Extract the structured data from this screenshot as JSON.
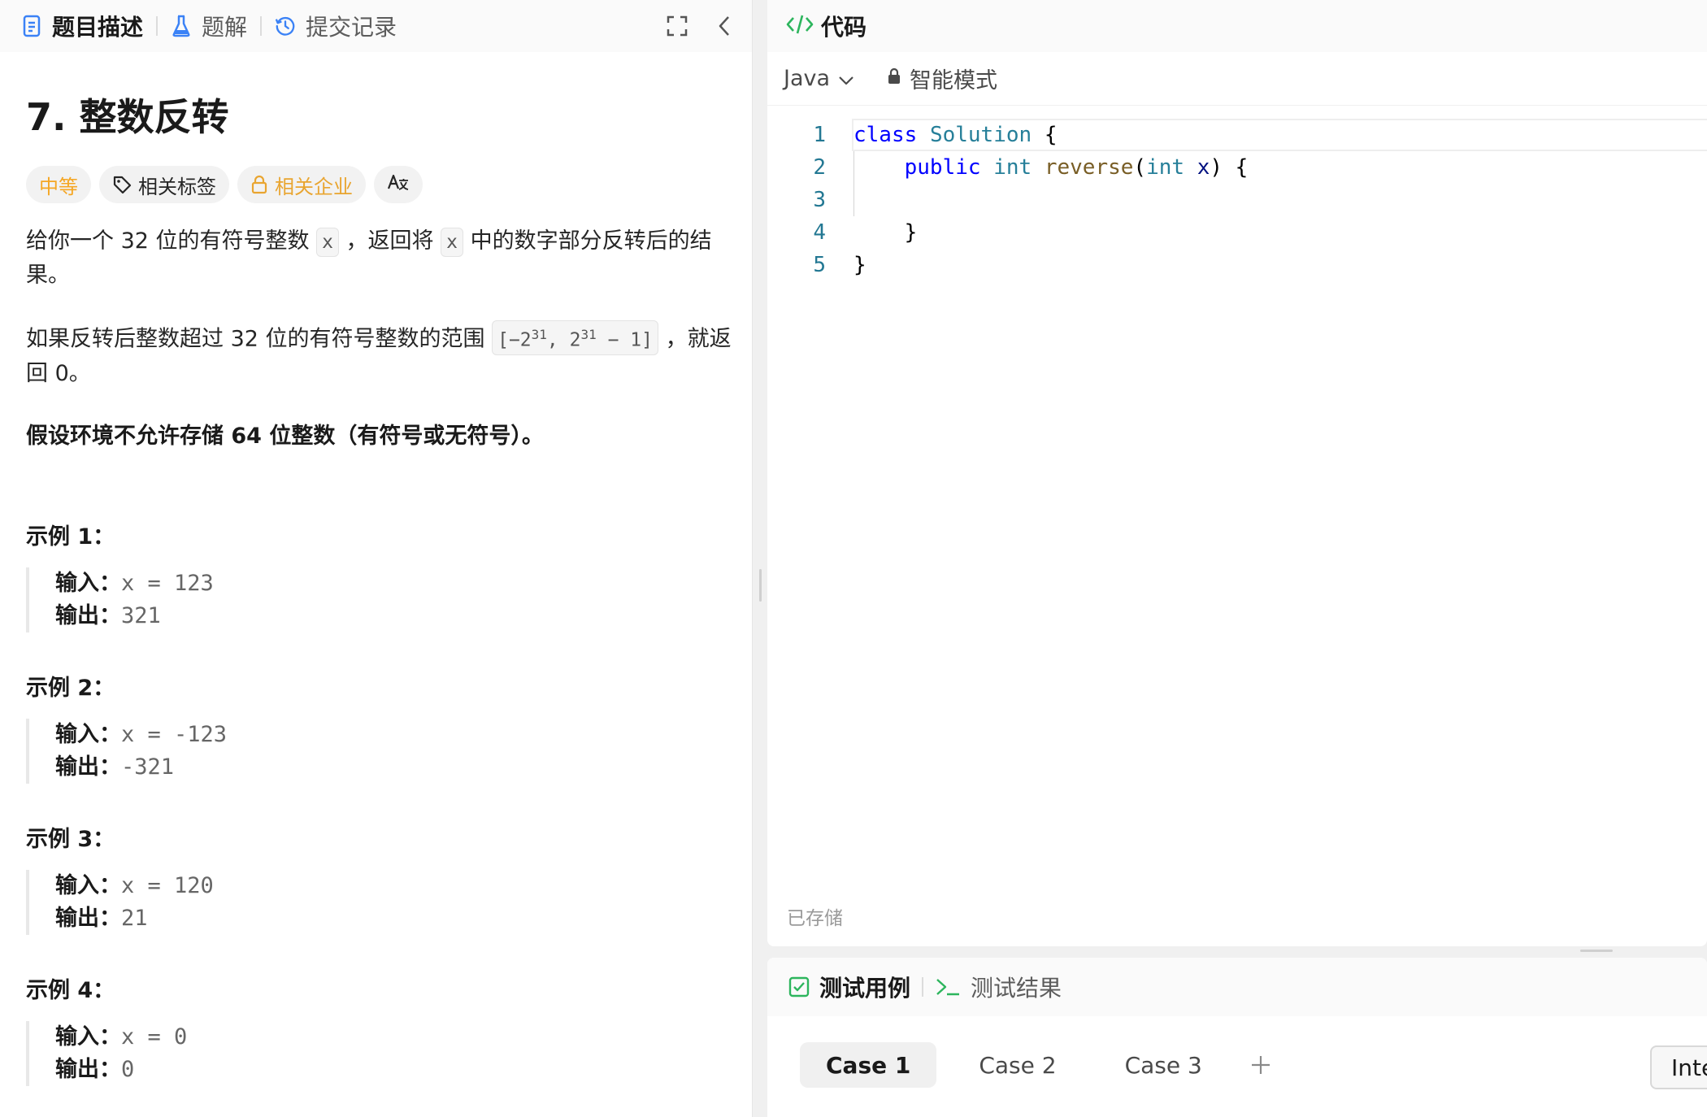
{
  "left": {
    "tabs": [
      {
        "label": "题目描述"
      },
      {
        "label": "题解"
      },
      {
        "label": "提交记录"
      }
    ],
    "title": "7. 整数反转",
    "badges": {
      "difficulty": "中等",
      "tags": "相关标签",
      "companies": "相关企业"
    },
    "desc1": {
      "pre": "给你一个 32 位的有符号整数 ",
      "code1": "x",
      "mid": " ，返回将 ",
      "code2": "x",
      "post": " 中的数字部分反转后的结果。"
    },
    "desc2": {
      "pre": "如果反转后整数超过 32 位的有符号整数的范围 ",
      "range_a": "[−2",
      "exp1": "31",
      "range_b": ",  2",
      "exp2": "31",
      "range_c": " − 1]",
      "post": " ，就返回 0。"
    },
    "desc3": "假设环境不允许存储 64 位整数（有符号或无符号）。",
    "input_label": "输入：",
    "output_label": "输出：",
    "examples": [
      {
        "title": "示例 1：",
        "input": "x = 123",
        "output": "321"
      },
      {
        "title": "示例 2：",
        "input": "x = -123",
        "output": "-321"
      },
      {
        "title": "示例 3：",
        "input": "x = 120",
        "output": "21"
      },
      {
        "title": "示例 4：",
        "input": "x = 0",
        "output": "0"
      }
    ]
  },
  "code": {
    "header": "代码",
    "language": "Java",
    "mode": "智能模式",
    "line_numbers": [
      "1",
      "2",
      "3",
      "4",
      "5"
    ],
    "tokens": {
      "kw_class": "class",
      "cls_name": "Solution",
      "brace_open": " {",
      "kw_public": "public",
      "kw_int": "int",
      "fn_name": "reverse",
      "paren_open": "(",
      "param_type": "int",
      "param_name": "x",
      "paren_close": ") {",
      "inner_close": "}",
      "outer_close": "}"
    },
    "saved": "已存储"
  },
  "tests": {
    "tabs": [
      {
        "label": "测试用例"
      },
      {
        "label": "测试结果"
      }
    ],
    "cases": [
      "Case 1",
      "Case 2",
      "Case 3"
    ],
    "interpreter_button": "Interpret"
  },
  "colors": {
    "difficulty": "#f5a623",
    "accent_green": "#2db55d",
    "line_number": "#237893",
    "keyword": "#0000ff",
    "type": "#267f99",
    "function": "#795e26"
  }
}
